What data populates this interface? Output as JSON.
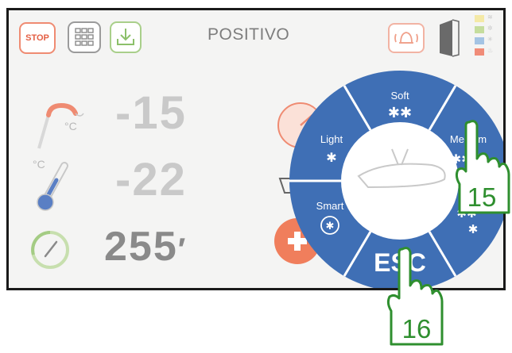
{
  "toolbar": {
    "stop_label": "STOP",
    "mode_label": "POSITIVO"
  },
  "readouts": {
    "probe_temp": "-15",
    "probe_unit": "°C",
    "chamber_temp": "-22",
    "chamber_unit": "°C",
    "time": "255",
    "time_unit": "′"
  },
  "wheel": {
    "soft": "Soft",
    "medium": "Medium",
    "light": "Light",
    "smart": "Smart",
    "esc": "ESC"
  },
  "annotations": {
    "hand_15": "15",
    "hand_16": "16"
  },
  "colors": {
    "wheel_blue": "#3f6fb5",
    "stop_orange": "#e45f44",
    "plus_orange": "#f07e5c",
    "hand_green": "#2f8f2f"
  }
}
